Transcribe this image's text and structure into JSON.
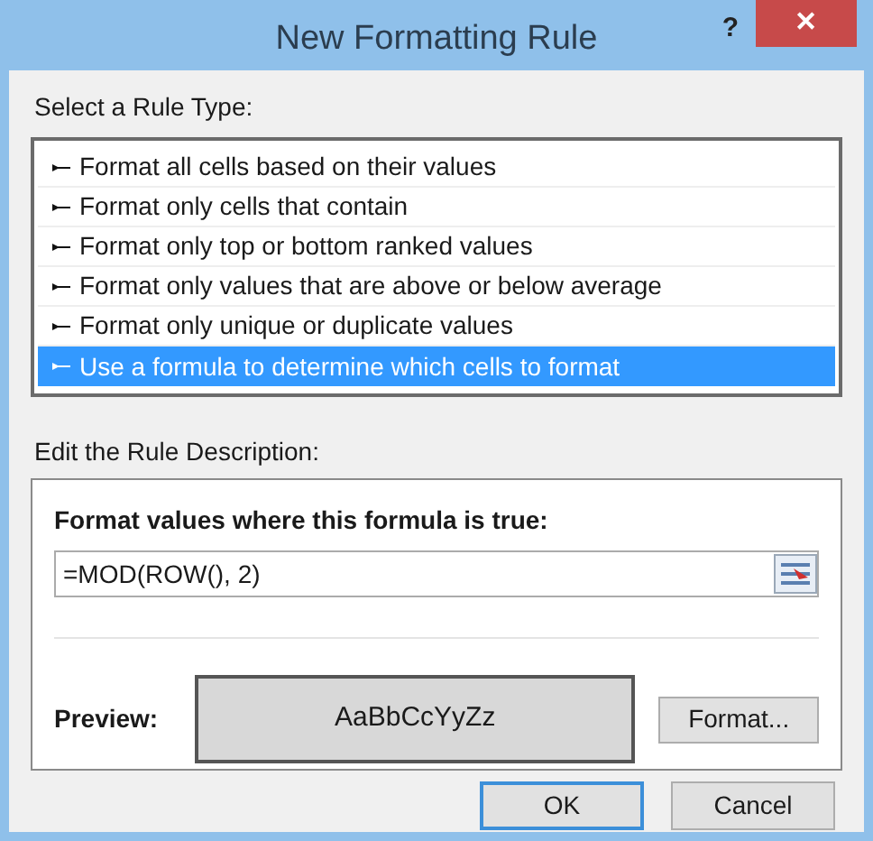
{
  "window": {
    "title": "New Formatting Rule",
    "help": "?",
    "close": "✕"
  },
  "rule_type": {
    "label": "Select a Rule Type:",
    "items": [
      {
        "label": "Format all cells based on their values",
        "selected": false
      },
      {
        "label": "Format only cells that contain",
        "selected": false
      },
      {
        "label": "Format only top or bottom ranked values",
        "selected": false
      },
      {
        "label": "Format only values that are above or below average",
        "selected": false
      },
      {
        "label": "Format only unique or duplicate values",
        "selected": false
      },
      {
        "label": "Use a formula to determine which cells to format",
        "selected": true
      }
    ]
  },
  "description": {
    "label": "Edit the Rule Description:",
    "formula_label": "Format values where this formula is true:",
    "formula": "=MOD(ROW(), 2)",
    "preview_label": "Preview:",
    "preview_text": "AaBbCcYyZz",
    "format_button": "Format..."
  },
  "buttons": [
    {
      "label": "OK",
      "default": true
    },
    {
      "label": "Cancel",
      "default": false
    }
  ]
}
